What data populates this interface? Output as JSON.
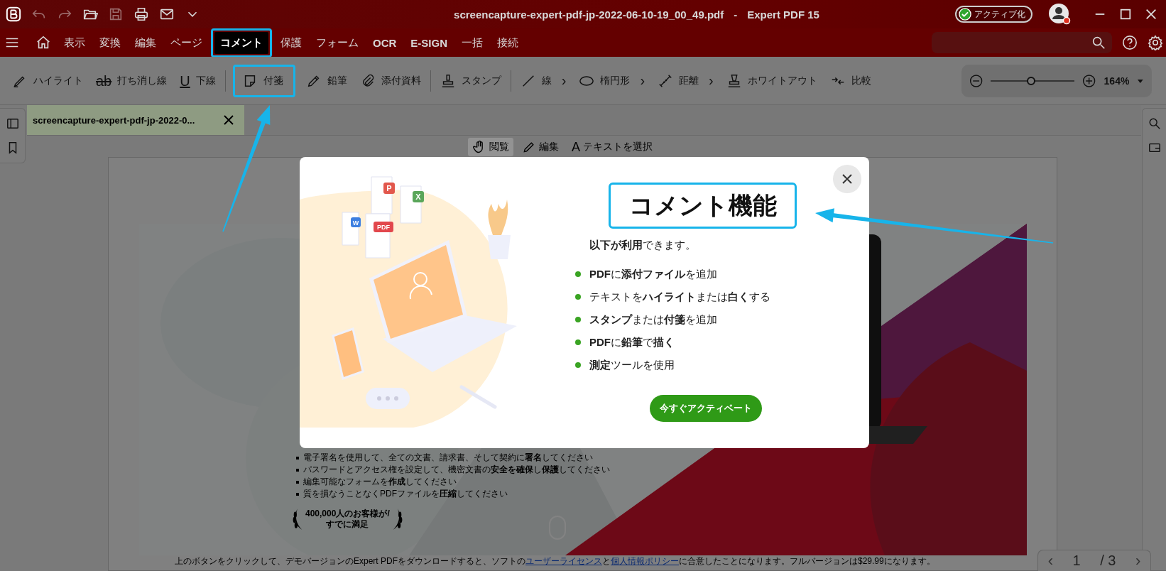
{
  "title_bar": {
    "file_name": "screencapture-expert-pdf-jp-2022-06-10-19_00_49.pdf",
    "separator": "-",
    "app_name": "Expert PDF 15",
    "activate_button": "アクティブ化"
  },
  "menu": {
    "items": [
      {
        "label": "表示",
        "selected": false
      },
      {
        "label": "変換",
        "selected": false
      },
      {
        "label": "編集",
        "selected": false
      },
      {
        "label": "ページ",
        "selected": false
      },
      {
        "label": "コメント",
        "selected": true
      },
      {
        "label": "保護",
        "selected": false
      },
      {
        "label": "フォーム",
        "selected": false
      },
      {
        "label": "OCR",
        "selected": false
      },
      {
        "label": "E-SIGN",
        "selected": false
      },
      {
        "label": "一括",
        "selected": false
      },
      {
        "label": "接続",
        "selected": false
      }
    ]
  },
  "toolbar": {
    "tool_groups": [
      [
        {
          "label": "ハイライト"
        },
        {
          "label": "打ち消し線",
          "icon_text": "ab"
        },
        {
          "label": "下線",
          "icon_text": "U"
        }
      ],
      [
        {
          "label": "付箋",
          "highlighted": true
        },
        {
          "label": "鉛筆"
        },
        {
          "label": "添付資料"
        }
      ],
      [
        {
          "label": "スタンプ"
        }
      ],
      [
        {
          "label": "線",
          "chevron": "›"
        },
        {
          "label": "楕円形",
          "chevron": "›"
        },
        {
          "label": "距離",
          "chevron": "›"
        },
        {
          "label": "ホワイトアウト"
        },
        {
          "label": "比較"
        }
      ]
    ],
    "zoom": {
      "level": 0.48,
      "value": "164%"
    }
  },
  "file_tab": {
    "label": "screencapture-expert-pdf-jp-2022-0..."
  },
  "view_modes": [
    {
      "label": "閲覧",
      "selected": true
    },
    {
      "label": "編集",
      "selected": false
    },
    {
      "label": "テキストを選択",
      "selected": false,
      "icon_text": "A"
    }
  ],
  "document": {
    "bullets": [
      "電子署名を使用して、全ての文書、請求書、そして契約に**署名**してください",
      "パスワードとアクセス権を設定して、機密文書の**安全を確保**し**保護**してください",
      "編集可能なフォームを**作成**してください",
      "質を損なうことなくPDFファイルを**圧縮**してください"
    ],
    "badge": [
      "400,000人のお客様が/",
      "すでに満足"
    ],
    "footer": [
      {
        "kind": "text",
        "text": "上のボタンをクリックして、デモバージョンのExpert PDFをダウンロードすると、ソフトの"
      },
      {
        "kind": "link",
        "text": "ユーザーライセンス"
      },
      {
        "kind": "text",
        "text": "と"
      },
      {
        "kind": "link",
        "text": "個人情報ポリシー"
      },
      {
        "kind": "text",
        "text": "に合意したことになります。フルバージョンは$29.99になります。"
      }
    ]
  },
  "pager": {
    "prev": "‹",
    "page": "1",
    "total": "/ 3",
    "next": "›"
  },
  "dialog": {
    "title": "コメント機能",
    "subtitle": "**以下が利用**できます。",
    "features": [
      "**PDF**に**添付ファイル**を追加",
      "テキストを**ハイライト**または**白く**する",
      "**スタンプ**または**付箋**を追加",
      "**PDF**に**鉛筆**で**描く**",
      "**測定**ツールを使用"
    ],
    "button": "今すぐアクティベート",
    "file_badges": [
      "P",
      "X",
      "W",
      "PDF"
    ]
  }
}
